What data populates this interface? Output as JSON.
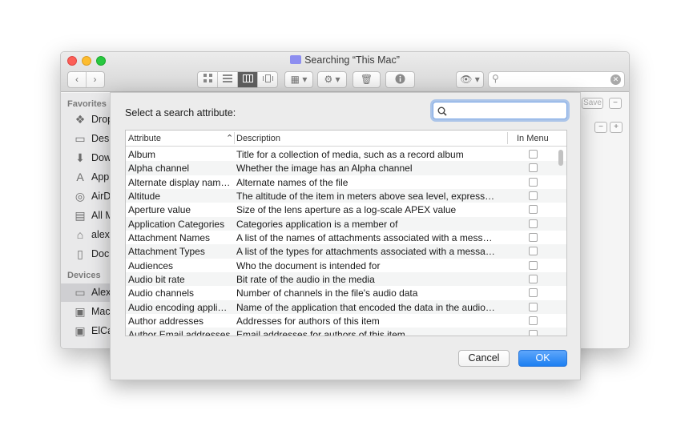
{
  "window": {
    "title": "Searching “This Mac”",
    "nav_back": "‹",
    "nav_forward": "›",
    "save_label": "Save",
    "minus_label": "−",
    "plus_label": "+"
  },
  "sidebar": {
    "favorites_heading": "Favorites",
    "devices_heading": "Devices",
    "favorites": [
      {
        "label": "Dropbox",
        "icon": "dropbox-icon"
      },
      {
        "label": "Desktop",
        "icon": "desktop-icon"
      },
      {
        "label": "Downloads",
        "icon": "downloads-icon"
      },
      {
        "label": "Applications",
        "icon": "applications-icon"
      },
      {
        "label": "AirDrop",
        "icon": "airdrop-icon"
      },
      {
        "label": "All My Files",
        "icon": "all-files-icon"
      },
      {
        "label": "alexa",
        "icon": "home-icon"
      },
      {
        "label": "Documents",
        "icon": "documents-icon"
      }
    ],
    "devices": [
      {
        "label": "Alex",
        "icon": "computer-icon",
        "selected": true
      },
      {
        "label": "Macintosh HD",
        "icon": "disk-icon"
      },
      {
        "label": "ElCapitan",
        "icon": "disk-icon"
      }
    ]
  },
  "sheet": {
    "prompt": "Select a search attribute:",
    "search_value": "",
    "columns": {
      "attribute": "Attribute",
      "description": "Description",
      "in_menu": "In Menu",
      "sort_indicator": "⌃"
    },
    "rows": [
      {
        "attribute": "Album",
        "description": "Title for a collection of media, such as a record album",
        "in_menu": false
      },
      {
        "attribute": "Alpha channel",
        "description": "Whether the image has an Alpha channel",
        "in_menu": false
      },
      {
        "attribute": "Alternate display nam…",
        "description": "Alternate names of the file",
        "in_menu": false
      },
      {
        "attribute": "Altitude",
        "description": "The altitude of the item in meters above sea level, express…",
        "in_menu": false
      },
      {
        "attribute": "Aperture value",
        "description": "Size of the lens aperture as a log-scale APEX value",
        "in_menu": false
      },
      {
        "attribute": "Application Categories",
        "description": "Categories application is a member of",
        "in_menu": false
      },
      {
        "attribute": "Attachment Names",
        "description": "A list of the names of attachments associated with a mess…",
        "in_menu": false
      },
      {
        "attribute": "Attachment Types",
        "description": "A list of the types for attachments associated with a messa…",
        "in_menu": false
      },
      {
        "attribute": "Audiences",
        "description": "Who the document is intended for",
        "in_menu": false
      },
      {
        "attribute": "Audio bit rate",
        "description": "Bit rate of the audio in the media",
        "in_menu": false
      },
      {
        "attribute": "Audio channels",
        "description": "Number of channels in the file's audio data",
        "in_menu": false
      },
      {
        "attribute": "Audio encoding appli…",
        "description": "Name of the application that encoded the data in the audio…",
        "in_menu": false
      },
      {
        "attribute": "Author addresses",
        "description": "Addresses for authors of this item",
        "in_menu": false
      },
      {
        "attribute": "Author Email addresses",
        "description": "Email addresses for authors of this item",
        "in_menu": false
      }
    ],
    "cancel_label": "Cancel",
    "ok_label": "OK"
  },
  "colors": {
    "accent": "#1c7ff1",
    "close": "#fc5f57",
    "minimize": "#fdbc2e",
    "maximize": "#28c840"
  }
}
